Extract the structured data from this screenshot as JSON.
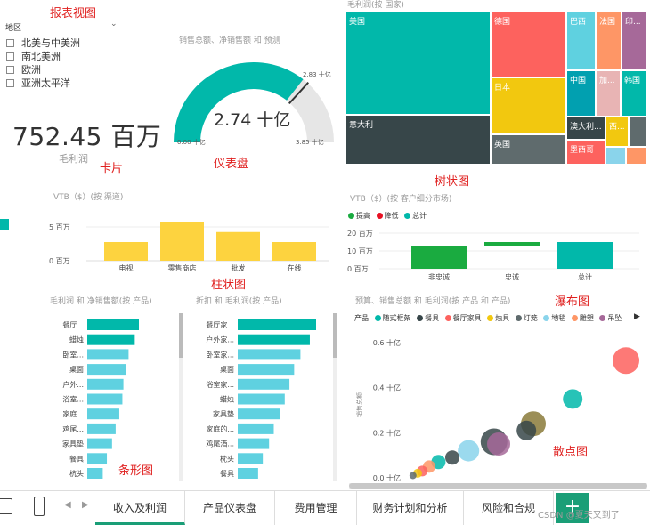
{
  "annotations": {
    "report_view": "报表视图",
    "card": "卡片",
    "gauge": "仪表盘",
    "treemap": "树状图",
    "column": "柱状图",
    "waterfall": "瀑布图",
    "bar": "条形图",
    "scatter": "散点图"
  },
  "slicer": {
    "title": "地区",
    "items": [
      "北美与中美洲",
      "南北美洲",
      "欧洲",
      "亚洲太平洋"
    ]
  },
  "card": {
    "value": "752.45 百万",
    "label": "毛利润"
  },
  "gauge": {
    "title": "销售总额、净销售额 和 预测",
    "value_label": "2.74 十亿",
    "min_label": "0.00 十亿",
    "max_label": "3.85 十亿",
    "target_label": "2.83 十亿",
    "value": 2.74,
    "min": 0,
    "max": 3.85,
    "target": 2.83,
    "fill_color": "#01b8aa",
    "track_color": "#e6e6e6"
  },
  "treemap": {
    "title": "毛利润(按 国家)",
    "tiles": [
      {
        "label": "美国",
        "color": "#01b8aa"
      },
      {
        "label": "德国",
        "color": "#fd625e"
      },
      {
        "label": "巴西",
        "color": "#5fd1e0"
      },
      {
        "label": "法国",
        "color": "#fe9666"
      },
      {
        "label": "印...",
        "color": "#a66999"
      },
      {
        "label": "日本",
        "color": "#f2c80f"
      },
      {
        "label": "中国",
        "color": "#01a0b0"
      },
      {
        "label": "加...",
        "color": "#e8b4b4"
      },
      {
        "label": "韩国",
        "color": "#01b8aa"
      },
      {
        "label": "意大利",
        "color": "#374649"
      },
      {
        "label": "英国",
        "color": "#5f6b6d"
      },
      {
        "label": "澳大利...",
        "color": "#374649"
      },
      {
        "label": "西...",
        "color": "#f2c80f"
      },
      {
        "label": "墨西哥",
        "color": "#fd625e"
      }
    ]
  },
  "column_chart": {
    "title": "VTB（$）(按 渠道)",
    "chart_data": {
      "type": "bar",
      "categories": [
        "电视",
        "零售商店",
        "批发",
        "在线"
      ],
      "values": [
        2.8,
        5.8,
        4.3,
        2.8
      ],
      "ylim": [
        0,
        6
      ],
      "yticks": [
        "5 百万",
        "0 百万"
      ],
      "color": "#fdd33f"
    }
  },
  "waterfall": {
    "title": "VTB（$）(按 客户细分市场)",
    "legend": [
      {
        "label": "提高",
        "color": "#1aab40"
      },
      {
        "label": "降低",
        "color": "#e81123"
      },
      {
        "label": "总计",
        "color": "#01b8aa"
      }
    ],
    "chart_data": {
      "type": "bar",
      "categories": [
        "非忠诚",
        "忠诚",
        "总计"
      ],
      "values": [
        13,
        2,
        15
      ],
      "bases": [
        0,
        13,
        0
      ],
      "ylim": [
        0,
        20
      ],
      "yticks": [
        "20 百万",
        "10 百万",
        "0 百万"
      ]
    }
  },
  "bar_left": {
    "title": "毛利润 和 净销售额(按 产品)",
    "chart_data": {
      "type": "bar",
      "categories": [
        "餐厅...",
        "蜡烛",
        "卧室...",
        "桌面",
        "户外...",
        "浴室...",
        "家庭...",
        "鸡尾...",
        "家具垫",
        "餐具",
        "杭头"
      ],
      "values": [
        100,
        92,
        80,
        75,
        70,
        68,
        62,
        55,
        48,
        38,
        30
      ],
      "colors": [
        "#01b8aa",
        "#5fd1e0"
      ]
    }
  },
  "bar_mid": {
    "title": "折扣 和 毛利润(按 产品)",
    "chart_data": {
      "type": "bar",
      "categories": [
        "餐厅家...",
        "户外家...",
        "卧室家...",
        "桌面",
        "浴室家...",
        "蜡烛",
        "家具垫",
        "家庭的...",
        "鸡尾酒...",
        "枕头",
        "餐具"
      ],
      "values": [
        100,
        92,
        80,
        72,
        66,
        60,
        54,
        46,
        40,
        32,
        26
      ],
      "colors": [
        "#01b8aa",
        "#5fd1e0"
      ]
    }
  },
  "scatter": {
    "title": "预算、销售总额 和 毛利润(按 产品 和 产品)",
    "legend_title": "产品",
    "legend": [
      {
        "label": "随式框架",
        "color": "#01b8aa"
      },
      {
        "label": "餐具",
        "color": "#374649"
      },
      {
        "label": "餐厅家具",
        "color": "#fd625e"
      },
      {
        "label": "烛具",
        "color": "#f2c80f"
      },
      {
        "label": "灯笼",
        "color": "#5f6b6d"
      },
      {
        "label": "地毯",
        "color": "#8ad4eb"
      },
      {
        "label": "雕塑",
        "color": "#fe9666"
      },
      {
        "label": "吊坠",
        "color": "#a66999"
      }
    ],
    "chart_data": {
      "type": "scatter",
      "ylabel": "销售总额",
      "yticks": [
        "0.6 十亿",
        "0.4 十亿",
        "0.2 十亿",
        "0.0 十亿"
      ],
      "points": [
        {
          "x": 0.95,
          "y": 0.52,
          "r": 15,
          "color": "#fd625e"
        },
        {
          "x": 0.72,
          "y": 0.35,
          "r": 11,
          "color": "#01b8aa"
        },
        {
          "x": 0.55,
          "y": 0.24,
          "r": 14,
          "color": "#8a7a3a"
        },
        {
          "x": 0.52,
          "y": 0.21,
          "r": 11,
          "color": "#374649"
        },
        {
          "x": 0.38,
          "y": 0.16,
          "r": 15,
          "color": "#374649"
        },
        {
          "x": 0.4,
          "y": 0.15,
          "r": 13,
          "color": "#a66999"
        },
        {
          "x": 0.27,
          "y": 0.12,
          "r": 12,
          "color": "#8ad4eb"
        },
        {
          "x": 0.2,
          "y": 0.09,
          "r": 8,
          "color": "#374649"
        },
        {
          "x": 0.14,
          "y": 0.07,
          "r": 8,
          "color": "#01b8aa"
        },
        {
          "x": 0.1,
          "y": 0.05,
          "r": 7,
          "color": "#fe9666"
        },
        {
          "x": 0.07,
          "y": 0.03,
          "r": 6,
          "color": "#fd625e"
        },
        {
          "x": 0.05,
          "y": 0.02,
          "r": 5,
          "color": "#f2c80f"
        },
        {
          "x": 0.03,
          "y": 0.01,
          "r": 4,
          "color": "#5f6b6d"
        }
      ]
    }
  },
  "tabs": [
    "收入及利润",
    "产品仪表盘",
    "费用管理",
    "财务计划和分析",
    "风险和合规"
  ],
  "active_tab": 0,
  "watermark": "CSDN @夏天又到了"
}
